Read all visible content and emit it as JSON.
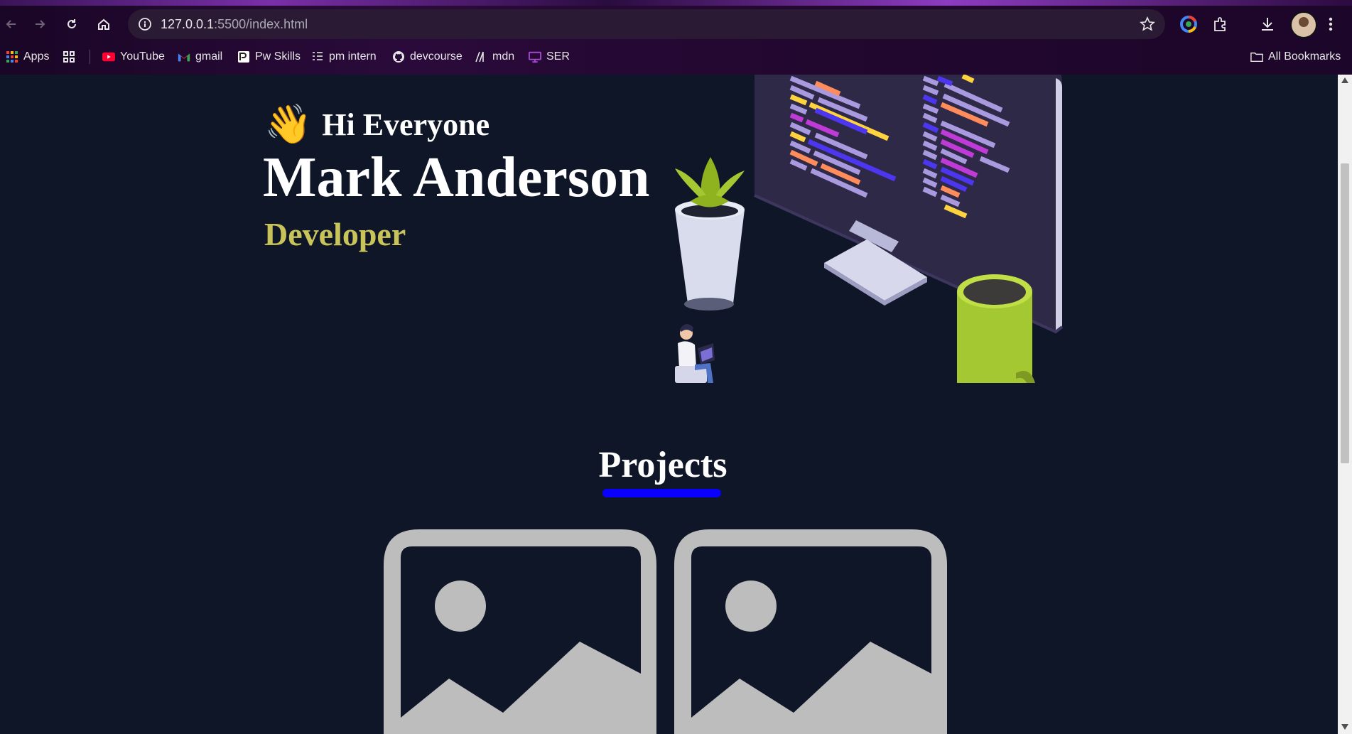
{
  "browser": {
    "url_host": "127.0.0.1",
    "url_path": ":5500/index.html"
  },
  "bookmarks": [
    {
      "label": "Apps",
      "icon": "apps-grid-icon"
    },
    {
      "label": "",
      "icon": "tab-groups-icon"
    },
    {
      "label": "YouTube",
      "icon": "youtube-icon"
    },
    {
      "label": "gmail",
      "icon": "gmail-icon"
    },
    {
      "label": "Pw Skills",
      "icon": "pw-skills-icon"
    },
    {
      "label": "pm intern",
      "icon": "pm-intern-icon"
    },
    {
      "label": "devcourse",
      "icon": "github-icon"
    },
    {
      "label": "mdn",
      "icon": "mdn-icon"
    },
    {
      "label": "SER",
      "icon": "ser-icon"
    }
  ],
  "all_bookmarks": "All Bookmarks",
  "hero": {
    "greeting": "Hi Everyone",
    "wave_emoji": "👋",
    "name": "Mark Anderson",
    "role": "Developer"
  },
  "projects": {
    "title": "Projects",
    "cards": [
      {
        "icon": "image-placeholder-icon"
      },
      {
        "icon": "image-placeholder-icon"
      }
    ]
  },
  "colors": {
    "page_bg": "#0f1627",
    "role_text": "#c8c45a",
    "underline": "#0a00ff",
    "placeholder": "#bdbdbd"
  }
}
